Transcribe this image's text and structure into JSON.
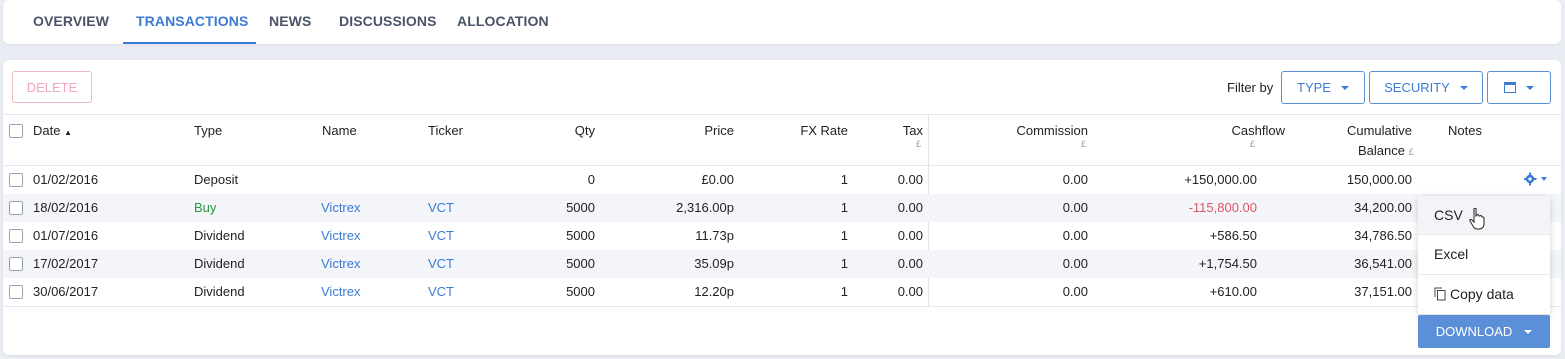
{
  "tabs": [
    {
      "label": "OVERVIEW"
    },
    {
      "label": "TRANSACTIONS",
      "active": true
    },
    {
      "label": "NEWS"
    },
    {
      "label": "DISCUSSIONS"
    },
    {
      "label": "ALLOCATION"
    }
  ],
  "toolbar": {
    "delete_label": "DELETE",
    "filter_label": "Filter by",
    "type_label": "TYPE",
    "security_label": "SECURITY",
    "calendar_icon": "calendar-icon"
  },
  "table": {
    "headers": {
      "date": "Date",
      "type": "Type",
      "name": "Name",
      "ticker": "Ticker",
      "qty": "Qty",
      "price": "Price",
      "fx_rate": "FX Rate",
      "tax": "Tax",
      "tax_unit": "£",
      "commission": "Commission",
      "commission_unit": "£",
      "cashflow": "Cashflow",
      "cashflow_unit": "£",
      "cumulative_1": "Cumulative",
      "cumulative_2": "Balance",
      "cumulative_unit": "£",
      "notes": "Notes"
    },
    "rows": [
      {
        "date": "01/02/2016",
        "type": "Deposit",
        "name": "",
        "ticker": "",
        "qty": "0",
        "price": "£0.00",
        "fx": "1",
        "tax": "0.00",
        "commission": "0.00",
        "cashflow": "+150,000.00",
        "balance": "150,000.00"
      },
      {
        "date": "18/02/2016",
        "type": "Buy",
        "name": "Victrex",
        "ticker": "VCT",
        "qty": "5000",
        "price": "2,316.00p",
        "fx": "1",
        "tax": "0.00",
        "commission": "0.00",
        "cashflow": "-115,800.00",
        "balance": "34,200.00"
      },
      {
        "date": "01/07/2016",
        "type": "Dividend",
        "name": "Victrex",
        "ticker": "VCT",
        "qty": "5000",
        "price": "11.73p",
        "fx": "1",
        "tax": "0.00",
        "commission": "0.00",
        "cashflow": "+586.50",
        "balance": "34,786.50"
      },
      {
        "date": "17/02/2017",
        "type": "Dividend",
        "name": "Victrex",
        "ticker": "VCT",
        "qty": "5000",
        "price": "35.09p",
        "fx": "1",
        "tax": "0.00",
        "commission": "0.00",
        "cashflow": "+1,754.50",
        "balance": "36,541.00"
      },
      {
        "date": "30/06/2017",
        "type": "Dividend",
        "name": "Victrex",
        "ticker": "VCT",
        "qty": "5000",
        "price": "12.20p",
        "fx": "1",
        "tax": "0.00",
        "commission": "0.00",
        "cashflow": "+610.00",
        "balance": "37,151.00"
      }
    ]
  },
  "download_menu": {
    "items": [
      {
        "label": "CSV"
      },
      {
        "label": "Excel"
      },
      {
        "label": "Copy data"
      }
    ],
    "button_label": "DOWNLOAD"
  },
  "colors": {
    "accent": "#3b7bd4",
    "buy": "#2b9a3c",
    "negative": "#e0546a",
    "delete": "#f2a6b8"
  }
}
